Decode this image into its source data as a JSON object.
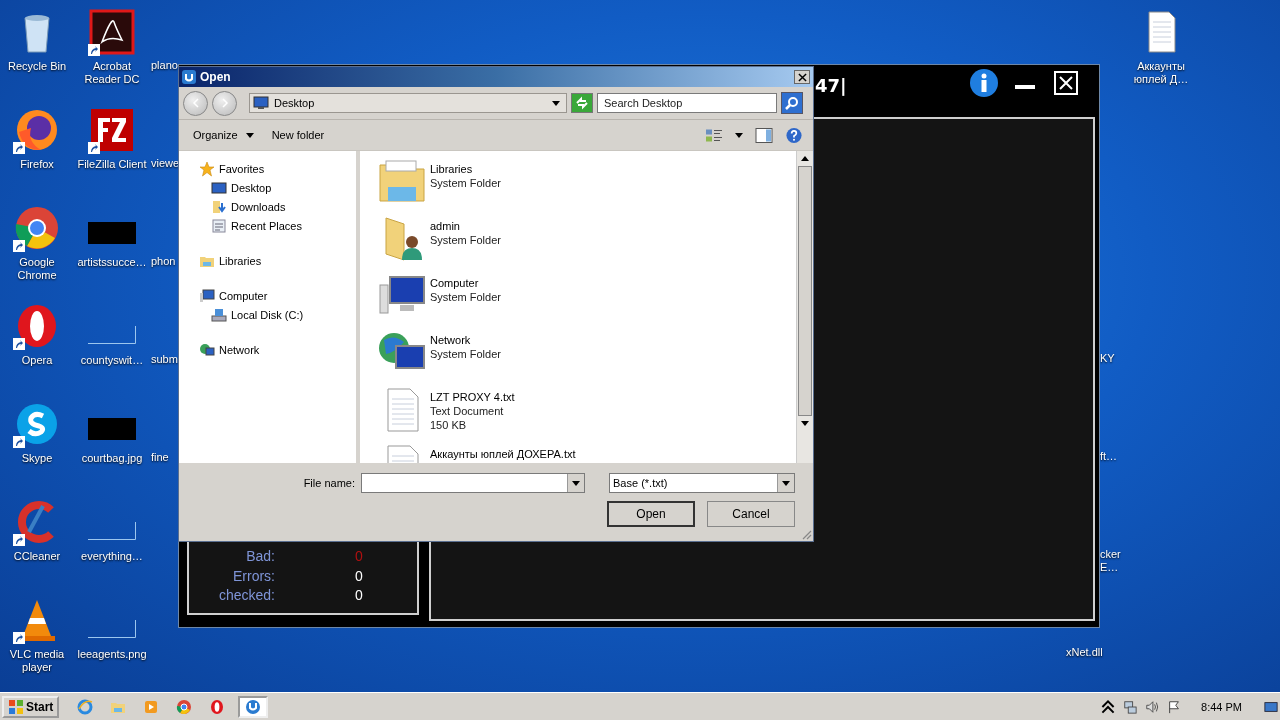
{
  "desktop": {
    "icon_columns": [
      [
        {
          "label": "Recycle Bin",
          "kind": "recycle-bin"
        },
        {
          "label": "Firefox",
          "kind": "firefox"
        },
        {
          "label": "Google Chrome",
          "kind": "chrome"
        },
        {
          "label": "Opera",
          "kind": "opera"
        },
        {
          "label": "Skype",
          "kind": "skype"
        },
        {
          "label": "CCleaner",
          "kind": "ccleaner"
        },
        {
          "label": "VLC media player",
          "kind": "vlc"
        }
      ],
      [
        {
          "label": "Acrobat Reader DC",
          "kind": "acrobat"
        },
        {
          "label": "FileZilla Client",
          "kind": "filezilla"
        },
        {
          "label": "artistssucce…",
          "kind": "dark-image"
        },
        {
          "label": "countyswit…",
          "kind": "blank-image"
        },
        {
          "label": "courtbag.jpg",
          "kind": "dark-image"
        },
        {
          "label": "everything…",
          "kind": "blank-image"
        },
        {
          "label": "leeagents.png",
          "kind": "blank-image"
        }
      ]
    ],
    "partial_labels_left": [
      "plano",
      "viewe",
      "phon",
      "subm",
      "fine"
    ],
    "right_icon": {
      "label": "Аккаунты юплей Д…",
      "kind": "text-file"
    },
    "partial_labels_right": [
      [
        "KY"
      ],
      [
        "ft…"
      ],
      [
        "cker",
        "E…"
      ],
      [
        "xNet.dll"
      ]
    ]
  },
  "app_window": {
    "title": "47|",
    "stats": [
      {
        "label": "Bad:",
        "value": "0",
        "color": "#b01010"
      },
      {
        "label": "Errors:",
        "value": "0",
        "color": "#ffffff"
      },
      {
        "label": "checked:",
        "value": "0",
        "color": "#ffffff"
      }
    ]
  },
  "dialog": {
    "title": "Open",
    "address": "Desktop",
    "search": {
      "placeholder": "Search Desktop"
    },
    "toolbar": [
      "Organize",
      "New folder"
    ],
    "sidebar": [
      {
        "label": "Favorites",
        "kind": "star",
        "children": [
          {
            "label": "Desktop",
            "kind": "desktop"
          },
          {
            "label": "Downloads",
            "kind": "downloads"
          },
          {
            "label": "Recent Places",
            "kind": "recent"
          }
        ]
      },
      {
        "label": "Libraries",
        "kind": "libraries"
      },
      {
        "label": "Computer",
        "kind": "computer",
        "children": [
          {
            "label": "Local Disk (C:)",
            "kind": "disk"
          }
        ]
      },
      {
        "label": "Network",
        "kind": "network"
      }
    ],
    "files": [
      {
        "name": "Libraries",
        "details": [
          "System Folder"
        ],
        "kind": "libraries"
      },
      {
        "name": "admin",
        "details": [
          "System Folder"
        ],
        "kind": "user"
      },
      {
        "name": "Computer",
        "details": [
          "System Folder"
        ],
        "kind": "computer"
      },
      {
        "name": "Network",
        "details": [
          "System Folder"
        ],
        "kind": "network"
      },
      {
        "name": "LZT PROXY 4.txt",
        "details": [
          "Text Document",
          "150 KB"
        ],
        "kind": "text"
      },
      {
        "name": "Аккаунты юплей ДОХЕРА.txt",
        "kind": "text"
      }
    ],
    "file_name_label": "File name:",
    "file_type": "Base (*.txt)",
    "buttons": [
      "Open",
      "Cancel"
    ]
  },
  "taskbar": {
    "start": "Start",
    "apps": [
      {
        "kind": "ie",
        "selected": false
      },
      {
        "kind": "explorer",
        "selected": false
      },
      {
        "kind": "media",
        "selected": false
      },
      {
        "kind": "chrome",
        "selected": false
      },
      {
        "kind": "opera",
        "selected": false
      },
      {
        "kind": "app",
        "selected": true
      }
    ],
    "clock": "8:44 PM"
  }
}
